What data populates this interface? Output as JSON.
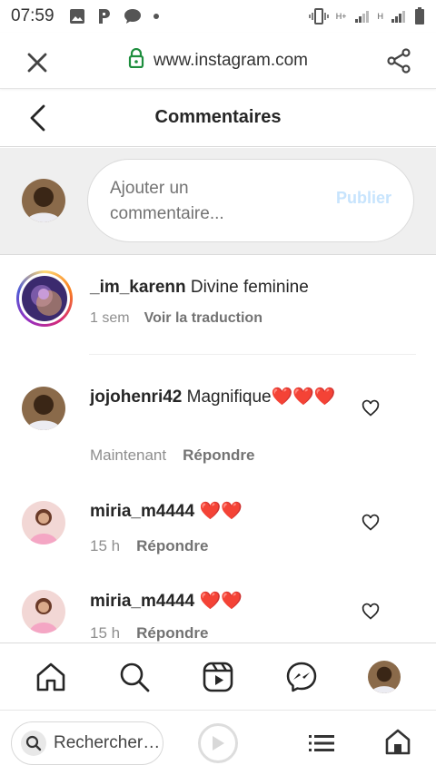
{
  "status": {
    "time": "07:59",
    "network_left": "H+",
    "network_right": "H"
  },
  "browser": {
    "url": "www.instagram.com",
    "search_placeholder": "Rechercher…"
  },
  "header": {
    "title": "Commentaires"
  },
  "composer": {
    "placeholder": "Ajouter un commentaire...",
    "publish_label": "Publier"
  },
  "caption": {
    "username": "_im_karenn",
    "text": "Divine feminine",
    "time": "1 sem",
    "translate_label": "Voir la traduction"
  },
  "comments": [
    {
      "username": "jojohenri42",
      "text": "Magnifique",
      "emoji": "❤️❤️❤️",
      "time": "Maintenant",
      "reply_label": "Répondre"
    },
    {
      "username": "miria_m4444",
      "text": "",
      "emoji": "❤️❤️",
      "time": "15 h",
      "reply_label": "Répondre"
    },
    {
      "username": "miria_m4444",
      "text": "",
      "emoji": "❤️❤️",
      "time": "15 h",
      "reply_label": "Répondre"
    }
  ],
  "colors": {
    "accent_disabled": "#c7e4fd",
    "heart": "#e31b23",
    "muted_text": "#8e8e8e"
  },
  "icons": {
    "bottom_nav": [
      "home-icon",
      "search-icon",
      "reels-icon",
      "messenger-icon",
      "profile-avatar"
    ],
    "browser_bottom": [
      "search-icon",
      "play-icon",
      "list-icon",
      "home-icon"
    ]
  }
}
